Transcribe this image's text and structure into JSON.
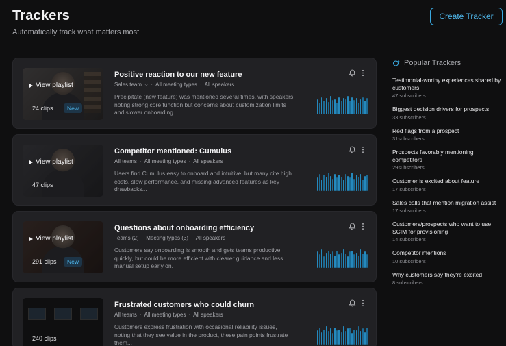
{
  "header": {
    "title": "Trackers",
    "subtitle": "Automatically track what matters most",
    "create_label": "Create Tracker"
  },
  "colors": {
    "accent": "#3aa9e0",
    "background": "#0f0f10",
    "card": "#212124",
    "bars": "#2589bd"
  },
  "trackers": [
    {
      "title": "Positive reaction to our new feature",
      "team": "Sales team",
      "meeting_types": "All meeting types",
      "speakers": "All speakers",
      "description": "Precipitate (new feature) was mentioned several times, with speakers noting strong core function but concerns about customization limits and slower onboarding...",
      "view_label": "View playlist",
      "clips": "24 clips",
      "badge": "New",
      "bars": [
        0.8,
        0.6,
        0.9,
        0.7,
        0.85,
        0.65,
        0.95,
        0.75,
        0.8,
        0.6,
        0.9,
        0.7,
        0.85,
        0.8,
        0.95,
        0.7,
        0.9,
        0.75,
        0.85,
        0.6,
        0.8,
        0.9,
        0.7,
        0.85
      ]
    },
    {
      "title": "Competitor mentioned: Cumulus",
      "team": "All teams",
      "meeting_types": "All meeting types",
      "speakers": "All speakers",
      "description": "Users find Cumulus easy to onboard and intuitive, but many cite high costs, slow performance, and missing advanced features as key drawbacks...",
      "view_label": "View playlist",
      "clips": "47 clips",
      "badge": "",
      "bars": [
        0.7,
        0.9,
        0.6,
        0.85,
        0.75,
        0.95,
        0.8,
        0.65,
        0.9,
        0.7,
        0.85,
        0.75,
        0.6,
        0.9,
        0.8,
        0.7,
        0.95,
        0.65,
        0.85,
        0.75,
        0.9,
        0.6,
        0.8,
        0.85
      ]
    },
    {
      "title": "Questions about onboarding efficiency",
      "team": "Teams (2)",
      "meeting_types": "Meeting types (3)",
      "speakers": "All speakers",
      "description": "Customers say onboarding is smooth and gets teams productive quickly, but could be more efficient with clearer guidance and less manual setup early on.",
      "view_label": "View playlist",
      "clips": "291 clips",
      "badge": "New",
      "bars": [
        0.85,
        0.7,
        0.95,
        0.6,
        0.8,
        0.9,
        0.75,
        0.85,
        0.65,
        0.9,
        0.7,
        0.8,
        0.95,
        0.75,
        0.6,
        0.85,
        0.9,
        0.7,
        0.8,
        0.65,
        0.95,
        0.75,
        0.85,
        0.7
      ]
    },
    {
      "title": "Frustrated customers who could churn",
      "team": "All teams",
      "meeting_types": "All meeting types",
      "speakers": "All speakers",
      "description": "Customers express frustration with occasional reliability issues, noting that they see value in the product, these pain points frustrate them...",
      "view_label": "",
      "clips": "240 clips",
      "badge": "",
      "bars": [
        0.75,
        0.9,
        0.65,
        0.8,
        0.95,
        0.7,
        0.85,
        0.6,
        0.9,
        0.75,
        0.8,
        0.65,
        0.95,
        0.7,
        0.85,
        0.9,
        0.6,
        0.8,
        0.75,
        0.95,
        0.7,
        0.85,
        0.65,
        0.9
      ]
    }
  ],
  "popular": {
    "title": "Popular Trackers",
    "items": [
      {
        "name": "Testimonial-worthy experiences shared by customers",
        "subs": "47 subscribers"
      },
      {
        "name": "Biggest decision drivers for prospects",
        "subs": "33 subscribers"
      },
      {
        "name": "Red flags from a prospect",
        "subs": "31subscribers"
      },
      {
        "name": "Prospects favorably mentioning competitors",
        "subs": "29subscribers"
      },
      {
        "name": "Customer is excited about feature",
        "subs": "17 subscribers"
      },
      {
        "name": "Sales calls that mention migration assist",
        "subs": "17 subscribers"
      },
      {
        "name": "Customers/prospects who want to use SCIM for provisioning",
        "subs": "14 subscribers"
      },
      {
        "name": "Competitor mentions",
        "subs": "10 subscribers"
      },
      {
        "name": "Why customers say they're excited",
        "subs": "8 subscribers"
      }
    ]
  }
}
